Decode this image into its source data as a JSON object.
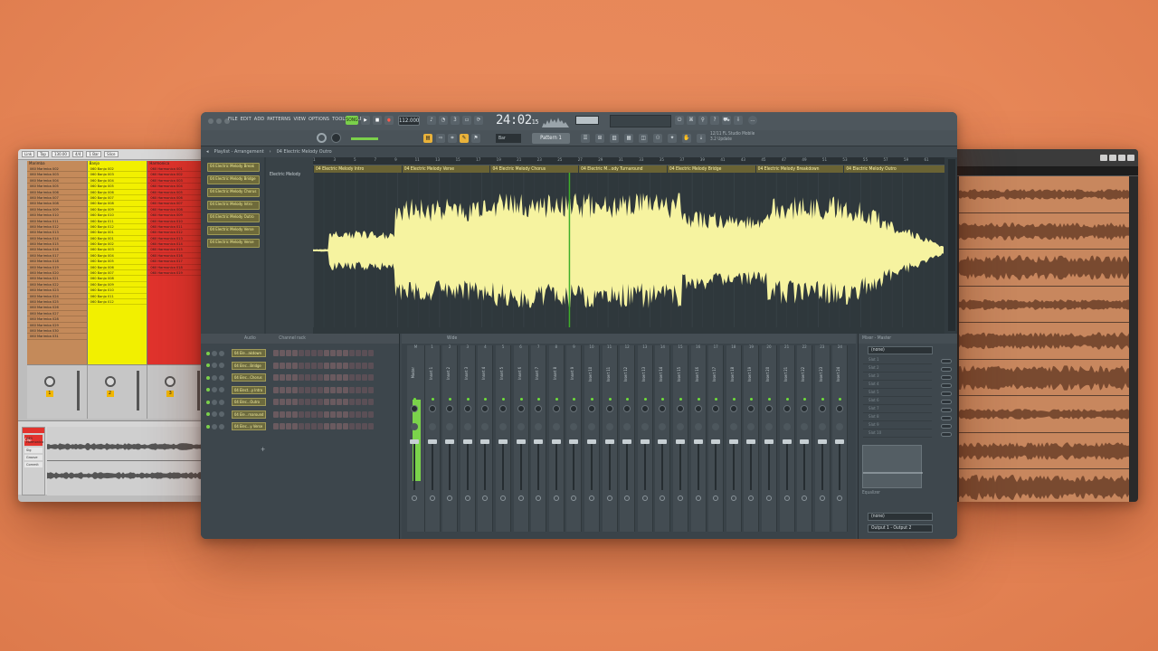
{
  "colors": {
    "background": "#e98e60",
    "waveform": "#f6f3a0",
    "clip_header": "#6a6334",
    "led_green": "#6fde3a",
    "red_clip": "#e2332d",
    "ableton_yellow": "#f2f000",
    "cubase_audio": "#c8875e"
  },
  "ableton": {
    "tabs": [
      "Link",
      "Tap",
      "130.00",
      "4/4",
      "1 Bar",
      "Slice"
    ],
    "columns": [
      {
        "header": "Marimba",
        "color": "#c48a5a",
        "clips": [
          "060 Marimba 002",
          "060 Marimba 003",
          "060 Marimba 004",
          "060 Marimba 005",
          "060 Marimba 006",
          "060 Marimba 007",
          "060 Marimba 008",
          "060 Marimba 009",
          "060 Marimba 010",
          "060 Marimba 011",
          "060 Marimba 012",
          "060 Marimba 013",
          "060 Marimba 014",
          "060 Marimba 015",
          "060 Marimba 016",
          "060 Marimba 017",
          "060 Marimba 018",
          "060 Marimba 019",
          "060 Marimba 020",
          "060 Marimba 021",
          "060 Marimba 022",
          "060 Marimba 023",
          "060 Marimba 024",
          "060 Marimba 025",
          "060 Marimba 026",
          "060 Marimba 027",
          "060 Marimba 028",
          "060 Marimba 029",
          "060 Marimba 030",
          "060 Marimba 031"
        ]
      },
      {
        "header": "Banjo",
        "color": "#f2f000",
        "clips": [
          "060 Banjo 002",
          "060 Banjo 003",
          "060 Banjo 004",
          "060 Banjo 005",
          "060 Banjo 006",
          "060 Banjo 007",
          "060 Banjo 008",
          "060 Banjo 009",
          "060 Banjo 010",
          "060 Banjo 011",
          "060 Banjo 012",
          "060 Banjo 001",
          "060 Banjo 001",
          "060 Banjo 002",
          "060 Banjo 003",
          "060 Banjo 004",
          "060 Banjo 005",
          "060 Banjo 006",
          "060 Banjo 007",
          "060 Banjo 008",
          "060 Banjo 009",
          "060 Banjo 010",
          "060 Banjo 011",
          "060 Banjo 012"
        ]
      },
      {
        "header": "Harmonica",
        "color": "#e2332d",
        "clips": [
          "060 Harmonica 001",
          "060 Harmonica 002",
          "060 Harmonica 003",
          "060 Harmonica 004",
          "060 Harmonica 005",
          "060 Harmonica 006",
          "060 Harmonica 007",
          "060 Harmonica 008",
          "060 Harmonica 009",
          "060 Harmonica 010",
          "060 Harmonica 011",
          "060 Harmonica 012",
          "060 Harmonica 013",
          "060 Harmonica 014",
          "060 Harmonica 015",
          "060 Harmonica 016",
          "060 Harmonica 017",
          "060 Harmonica 018",
          "060 Harmonica 019"
        ]
      }
    ],
    "mixer_numbers": [
      "1",
      "2",
      "3"
    ],
    "clip_title": "Clip",
    "clip_label": "060 Harmonica",
    "clip_fields": [
      "Sig",
      "Groove",
      "Commit"
    ]
  },
  "fl": {
    "menu": [
      "FILE",
      "EDIT",
      "ADD",
      "PATTERNS",
      "VIEW",
      "OPTIONS",
      "TOOLS",
      "HELP"
    ],
    "mode_label": "SONG",
    "tempo": "112.000",
    "clock_main": "24:02",
    "clock_sub": "15",
    "clock_unit": "B:S:T",
    "snap": "Bar",
    "pattern": "Pattern 1",
    "news_line1": "12/11 FL Studio Mobile",
    "news_line2": "3.2 Update",
    "playlist": {
      "title": "Playlist - Arrangement",
      "breadcrumb": "04 Electric Melody Outro",
      "track_name": "Electric Melody",
      "picker_clips": [
        "04 Electric Melody Break",
        "04 Electric Melody Bridge",
        "04 Electric Melody Chorus",
        "04 Electric Melody Intro",
        "04 Electric Melody Outro",
        "04 Electric Melody Verse",
        "04 Electric Melody Verse"
      ],
      "ruler": [
        "1",
        "3",
        "5",
        "7",
        "9",
        "11",
        "13",
        "15",
        "17",
        "19",
        "21",
        "23",
        "25",
        "27",
        "29",
        "31",
        "33",
        "35",
        "37",
        "39",
        "41",
        "43",
        "45",
        "47",
        "49",
        "51",
        "53",
        "55",
        "57",
        "59",
        "61"
      ],
      "segments": [
        {
          "label": "04 Electric Melody Intro",
          "start": 0,
          "end": 14
        },
        {
          "label": "04 Electric Melody Verse",
          "start": 14,
          "end": 28
        },
        {
          "label": "04 Electric Melody Chorus",
          "start": 28,
          "end": 42
        },
        {
          "label": "04 Electric M...ody Turnaround",
          "start": 42,
          "end": 56
        },
        {
          "label": "04 Electric Melody Bridge",
          "start": 56,
          "end": 70
        },
        {
          "label": "04 Electric Melody Breakdown",
          "start": 70,
          "end": 84
        },
        {
          "label": "04 Electric Melody Outro",
          "start": 84,
          "end": 100
        }
      ],
      "playhead_percent": 40.5
    },
    "channel_rack": {
      "title": "Channel rack",
      "filter": "Audio",
      "channels": [
        "04 Ele...akdown",
        "04 Elec...Bridge",
        "04 Elec...Chorus",
        "04 Elect...y Intro",
        "04 Elec...Outro",
        "04 Ele...rnaround",
        "04 Elec...y Verse"
      ]
    },
    "mixer": {
      "title": "Wide",
      "strip_numbers": [
        "M",
        "1",
        "2",
        "3",
        "4",
        "5",
        "6",
        "7",
        "8",
        "9",
        "10",
        "11",
        "12",
        "13",
        "14",
        "15",
        "16",
        "17",
        "18",
        "19",
        "20",
        "21",
        "22",
        "23",
        "24"
      ],
      "strip_labels": [
        "Master",
        "Insert 1",
        "Insert 2",
        "Insert 3",
        "Insert 4",
        "Insert 5",
        "Insert 6",
        "Insert 7",
        "Insert 8",
        "Insert 9",
        "Insert 10",
        "Insert 11",
        "Insert 12",
        "Insert 13",
        "Insert 14",
        "Insert 15",
        "Insert 16",
        "Insert 17",
        "Insert 18",
        "Insert 19",
        "Insert 20",
        "Insert 21",
        "Insert 22",
        "Insert 23",
        "Insert 24"
      ]
    },
    "insert": {
      "title": "Mixer - Master",
      "preset": "(none)",
      "slots": [
        "Slot 1",
        "Slot 2",
        "Slot 3",
        "Slot 4",
        "Slot 5",
        "Slot 6",
        "Slot 7",
        "Slot 8",
        "Slot 9",
        "Slot 10"
      ],
      "eq_label": "Equalizer",
      "output_none": "(none)",
      "output": "Output 1 - Output 2"
    }
  }
}
